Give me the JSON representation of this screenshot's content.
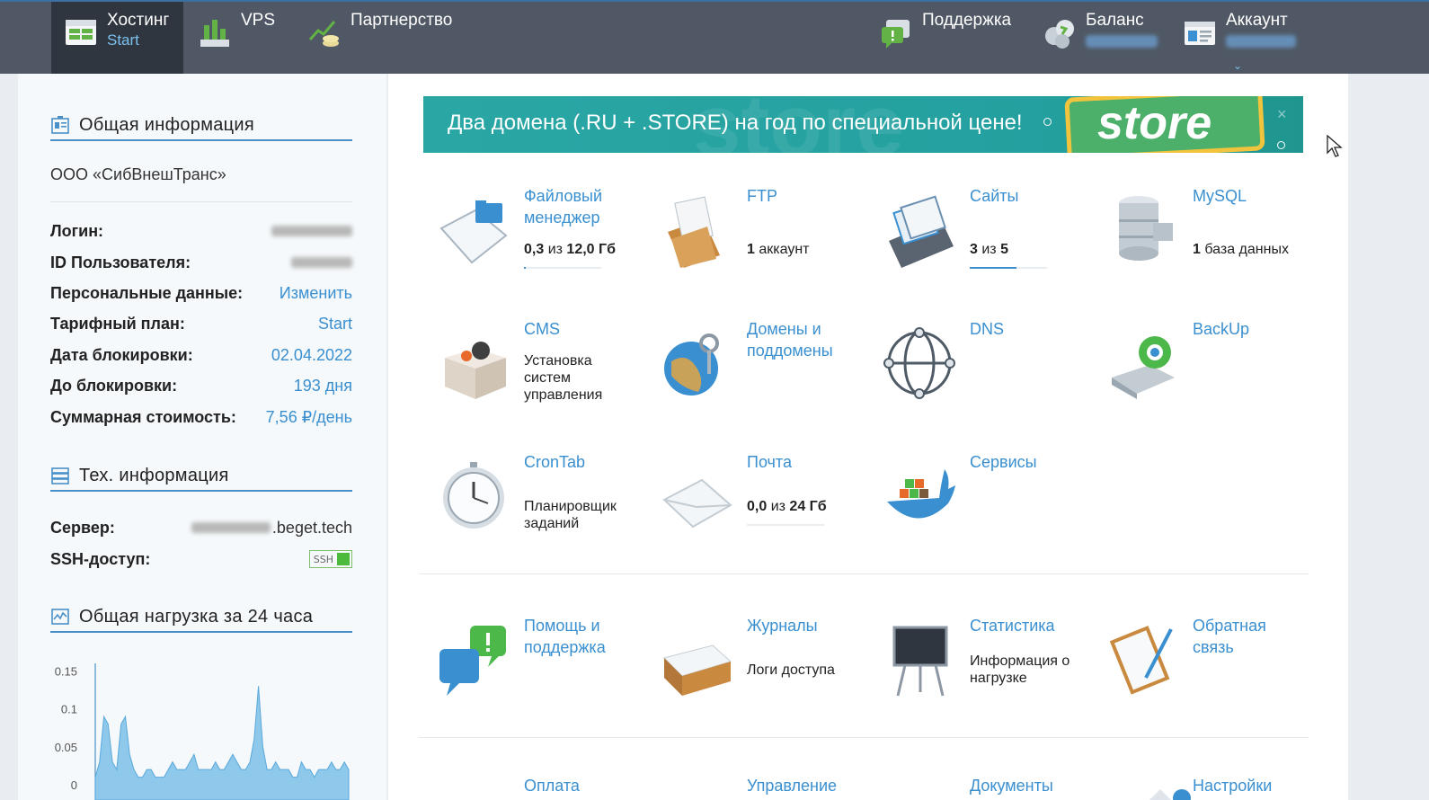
{
  "nav": {
    "hosting_title": "Хостинг",
    "hosting_sub": "Start",
    "vps": "VPS",
    "partnership": "Партнерство",
    "support": "Поддержка",
    "balance": "Баланс",
    "account": "Аккаунт"
  },
  "general": {
    "title": "Общая информация",
    "company": "ООО «СибВнешТранс»",
    "rows": [
      {
        "label": "Логин:"
      },
      {
        "label": "ID Пользователя:"
      },
      {
        "label": "Персональные данные:",
        "value": "Изменить"
      },
      {
        "label": "Тарифный план:",
        "value": "Start"
      },
      {
        "label": "Дата блокировки:",
        "value": "02.04.2022"
      },
      {
        "label": "До блокировки:",
        "value": "193 дня"
      },
      {
        "label": "Суммарная стоимость:",
        "value": "7,56 ₽/день"
      }
    ]
  },
  "tech": {
    "title": "Тех. информация",
    "server_label": "Сервер:",
    "server_suffix": ".beget.tech",
    "ssh_label": "SSH-доступ:",
    "ssh_badge": "SSH"
  },
  "load": {
    "title": "Общая нагрузка за 24 часа"
  },
  "banner": {
    "text": "Два домена (.RU + .STORE) на год по специальной цене!",
    "logo": "store",
    "close": "×"
  },
  "tiles": [
    {
      "title": "Файловый менеджер",
      "desc_bold": "0,3",
      "desc_mid": " из ",
      "desc_bold2": "12,0 Гб",
      "icon": "file-manager-icon",
      "progress": 0.025
    },
    {
      "title": "FTP",
      "desc_bold": "1",
      "desc_mid": " аккаунт",
      "desc_bold2": "",
      "icon": "ftp-icon"
    },
    {
      "title": "Сайты",
      "desc_bold": "3",
      "desc_mid": " из ",
      "desc_bold2": "5",
      "icon": "sites-icon",
      "progress": 0.6
    },
    {
      "title": "MySQL",
      "desc_bold": "1",
      "desc_mid": " база данных",
      "desc_bold2": "",
      "icon": "mysql-icon"
    },
    {
      "title": "CMS",
      "desc": "Установка систем управления",
      "icon": "cms-icon"
    },
    {
      "title": "Домены и поддомены",
      "desc": "",
      "icon": "domains-icon"
    },
    {
      "title": "DNS",
      "desc": "",
      "icon": "dns-icon"
    },
    {
      "title": "BackUp",
      "desc": "",
      "icon": "backup-icon"
    },
    {
      "title": "CronTab",
      "desc": "Планировщик заданий",
      "icon": "crontab-icon"
    },
    {
      "title": "Почта",
      "desc_bold": "0,0",
      "desc_mid": " из ",
      "desc_bold2": "24 Гб",
      "icon": "mail-icon",
      "progress": 0.0
    },
    {
      "title": "Сервисы",
      "desc": "",
      "icon": "services-icon"
    },
    {
      "title": "Помощь и поддержка",
      "desc": "",
      "icon": "help-icon"
    },
    {
      "title": "Журналы",
      "desc": "Логи доступа",
      "icon": "logs-icon"
    },
    {
      "title": "Статистика",
      "desc": "Информация о нагрузке",
      "icon": "stats-icon"
    },
    {
      "title": "Обратная связь",
      "desc": "",
      "icon": "feedback-icon"
    },
    {
      "title": "Оплата",
      "desc": "",
      "icon": "payment-icon"
    },
    {
      "title": "Управление",
      "desc": "",
      "icon": "management-icon"
    },
    {
      "title": "Документы",
      "desc": "",
      "icon": "documents-icon"
    },
    {
      "title": "Настройки",
      "desc": "",
      "icon": "settings-icon"
    }
  ],
  "chart_data": {
    "type": "area",
    "title": "",
    "xlabel": "",
    "ylabel": "",
    "y_ticks": [
      "0.15",
      "0.1",
      "0.05",
      "0"
    ],
    "ylim": [
      0,
      0.16
    ],
    "x": [
      0,
      1,
      2,
      3,
      4,
      5,
      6,
      7,
      8,
      9,
      10,
      11,
      12,
      13,
      14,
      15,
      16,
      17,
      18,
      19,
      20,
      21,
      22,
      23,
      24,
      25,
      26,
      27,
      28,
      29,
      30,
      31,
      32,
      33,
      34,
      35,
      36,
      37,
      38,
      39,
      40,
      41,
      42,
      43,
      44,
      45,
      46,
      47,
      48,
      49,
      50,
      51,
      52,
      53,
      54,
      55,
      56,
      57,
      58,
      59
    ],
    "values": [
      0.01,
      0.03,
      0.09,
      0.08,
      0.03,
      0.02,
      0.08,
      0.09,
      0.04,
      0.02,
      0.01,
      0.01,
      0.02,
      0.02,
      0.01,
      0.01,
      0.01,
      0.02,
      0.03,
      0.02,
      0.02,
      0.02,
      0.03,
      0.04,
      0.02,
      0.02,
      0.02,
      0.02,
      0.03,
      0.02,
      0.02,
      0.03,
      0.04,
      0.03,
      0.02,
      0.02,
      0.03,
      0.06,
      0.13,
      0.05,
      0.02,
      0.02,
      0.03,
      0.02,
      0.02,
      0.02,
      0.01,
      0.01,
      0.03,
      0.02,
      0.02,
      0.01,
      0.02,
      0.02,
      0.02,
      0.03,
      0.02,
      0.02,
      0.03,
      0.02
    ],
    "color": "#8ec8ea",
    "grid": false
  }
}
